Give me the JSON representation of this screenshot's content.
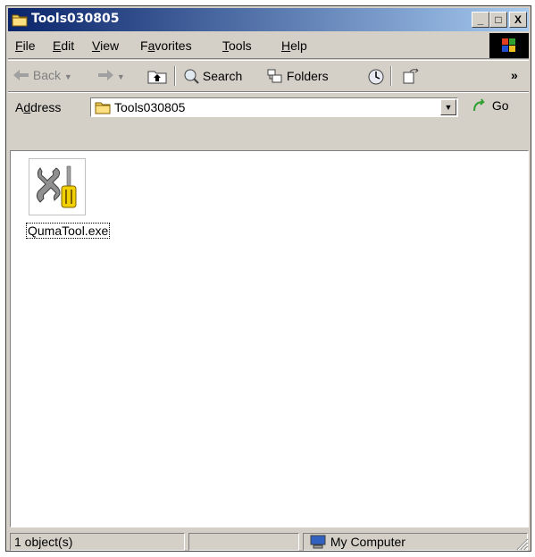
{
  "window": {
    "title": "Tools030805",
    "controls": {
      "minimize": "_",
      "maximize": "□",
      "close": "X"
    }
  },
  "menu": {
    "items": [
      {
        "label": "File",
        "accel": "F",
        "rest": "ile"
      },
      {
        "label": "Edit",
        "accel": "E",
        "rest": "dit"
      },
      {
        "label": "View",
        "accel": "V",
        "rest": "iew"
      },
      {
        "label": "Favorites",
        "pre": "F",
        "accel": "a",
        "rest": "vorites"
      },
      {
        "label": "Tools",
        "accel": "T",
        "rest": "ools"
      },
      {
        "label": "Help",
        "accel": "H",
        "rest": "elp"
      }
    ]
  },
  "toolbar": {
    "back_label": "Back",
    "search_label": "Search",
    "folders_label": "Folders",
    "more_glyph": "»"
  },
  "address": {
    "label_pre": "A",
    "label_accel": "d",
    "label_rest": "dress",
    "value": "Tools030805",
    "go_label": "Go"
  },
  "files": [
    {
      "name": "QumaTool.exe",
      "icon": "tools-icon"
    }
  ],
  "status": {
    "count": "1 object(s)",
    "zone": "My Computer"
  },
  "colors": {
    "titlebar_start": "#0a246a",
    "titlebar_end": "#a6caf0",
    "chrome": "#d4d0c8"
  }
}
